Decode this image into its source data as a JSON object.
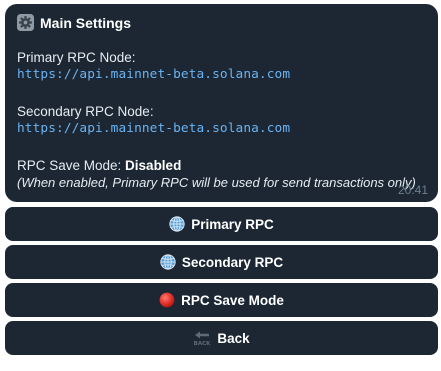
{
  "message": {
    "title": "Main Settings",
    "primary_label": "Primary RPC Node:",
    "primary_url": "https://api.mainnet-beta.solana.com",
    "secondary_label": "Secondary RPC Node:",
    "secondary_url": "https://api.mainnet-beta.solana.com",
    "save_mode_label": "RPC Save Mode: ",
    "save_mode_value": "Disabled",
    "note": "(When enabled, Primary RPC will be used for send transactions only)",
    "time": "20:41"
  },
  "buttons": [
    {
      "label": "Primary RPC",
      "icon": "globe-icon"
    },
    {
      "label": "Secondary RPC",
      "icon": "globe-icon"
    },
    {
      "label": "RPC Save Mode",
      "icon": "red-circle-icon"
    },
    {
      "label": "Back",
      "icon": "back-arrow-icon"
    }
  ],
  "colors": {
    "bubble_bg": "#1c2733",
    "link": "#6ab3f3",
    "time": "#6d7f8f",
    "status_red": "#e0302a"
  }
}
